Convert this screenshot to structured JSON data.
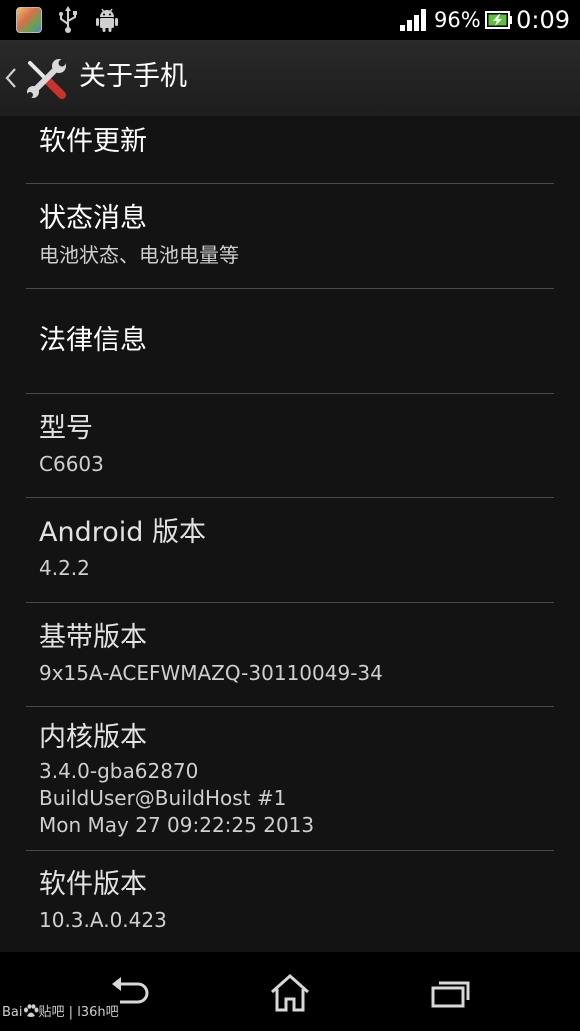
{
  "status_bar": {
    "battery_percent": "96%",
    "time": "0:09",
    "icons": [
      "app-notification-icon",
      "usb-icon",
      "android-debug-icon",
      "signal-icon",
      "battery-charging-icon"
    ]
  },
  "action_bar": {
    "title": "关于手机",
    "icons": [
      "chevron-left-icon",
      "tools-icon"
    ]
  },
  "items": [
    {
      "title": "软件更新",
      "subtitle": ""
    },
    {
      "title": "状态消息",
      "subtitle": "电池状态、电池电量等"
    },
    {
      "title": "法律信息",
      "subtitle": ""
    },
    {
      "title": "型号",
      "subtitle": "C6603"
    },
    {
      "title": "Android 版本",
      "subtitle": "4.2.2"
    },
    {
      "title": "基带版本",
      "subtitle": "9x15A-ACEFWMAZQ-30110049-34"
    },
    {
      "title": "内核版本",
      "subtitle": "3.4.0-gba62870\nBuildUser@BuildHost #1\nMon May 27 09:22:25 2013"
    },
    {
      "title": "软件版本",
      "subtitle": "10.3.A.0.423"
    }
  ],
  "nav_bar": {
    "icons": [
      "back-arrow-icon",
      "home-icon",
      "recent-apps-icon"
    ]
  },
  "watermark": {
    "brand_left": "Bai",
    "brand_right": "贴吧",
    "separator": "|",
    "site": "l36h吧"
  },
  "colors": {
    "background": "#131313",
    "divider": "#4a4a4a",
    "action_bar": "#232323",
    "status_text": "#ffffff",
    "battery_green": "#5cc23a"
  }
}
